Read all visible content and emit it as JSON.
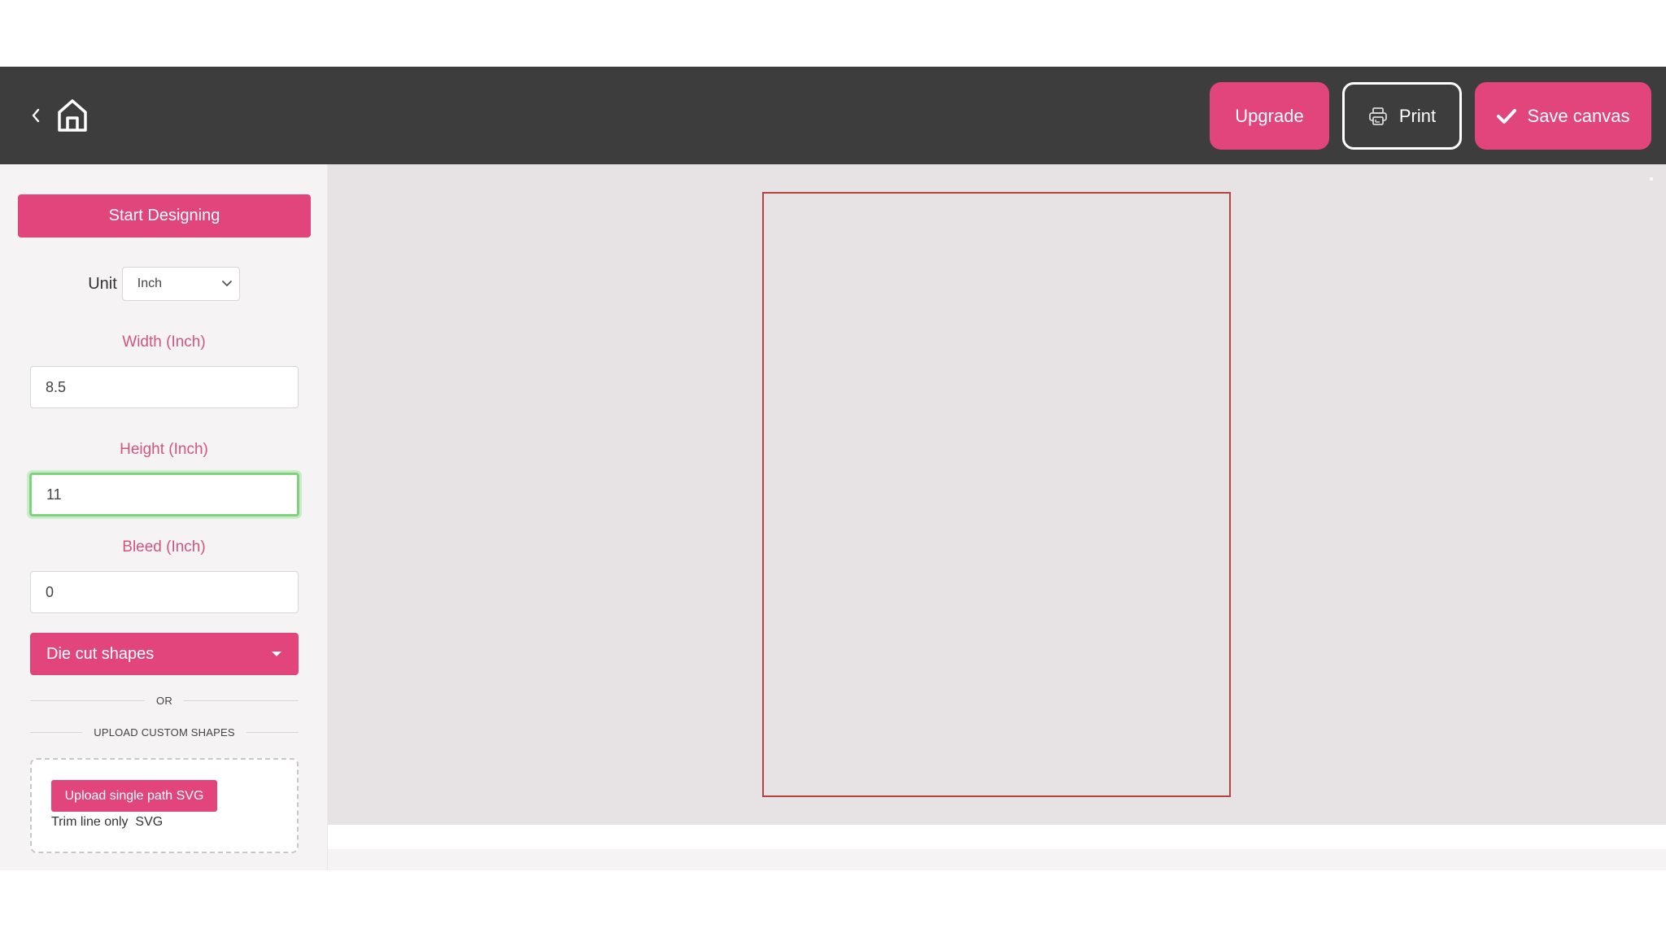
{
  "header": {
    "back_icon": "chevron-left-icon",
    "home_icon": "home-icon",
    "upgrade_label": "Upgrade",
    "print_label": "Print",
    "print_icon": "printer-icon",
    "save_label": "Save canvas",
    "save_icon": "check-icon"
  },
  "sidebar": {
    "start_label": "Start Designing",
    "unit_label": "Unit",
    "unit_value": "Inch",
    "width_label": "Width (Inch)",
    "width_value": "8.5",
    "height_label": "Height (Inch)",
    "height_value": "11",
    "bleed_label": "Bleed (Inch)",
    "bleed_value": "0",
    "diecut_label": "Die cut shapes",
    "or_label": "OR",
    "upload_section_label": "UPLOAD CUSTOM SHAPES",
    "upload_button_label": "Upload single path SVG",
    "trim_text": "Trim line only  SVG"
  },
  "canvas": {
    "width_in": 8.5,
    "height_in": 11,
    "bleed_in": 0
  },
  "colors": {
    "accent": "#e1457b",
    "header_bg": "#3d3d3d",
    "label_pink": "#d1567f",
    "trim_line": "#b5443a",
    "focus_green": "#7fd07f"
  }
}
